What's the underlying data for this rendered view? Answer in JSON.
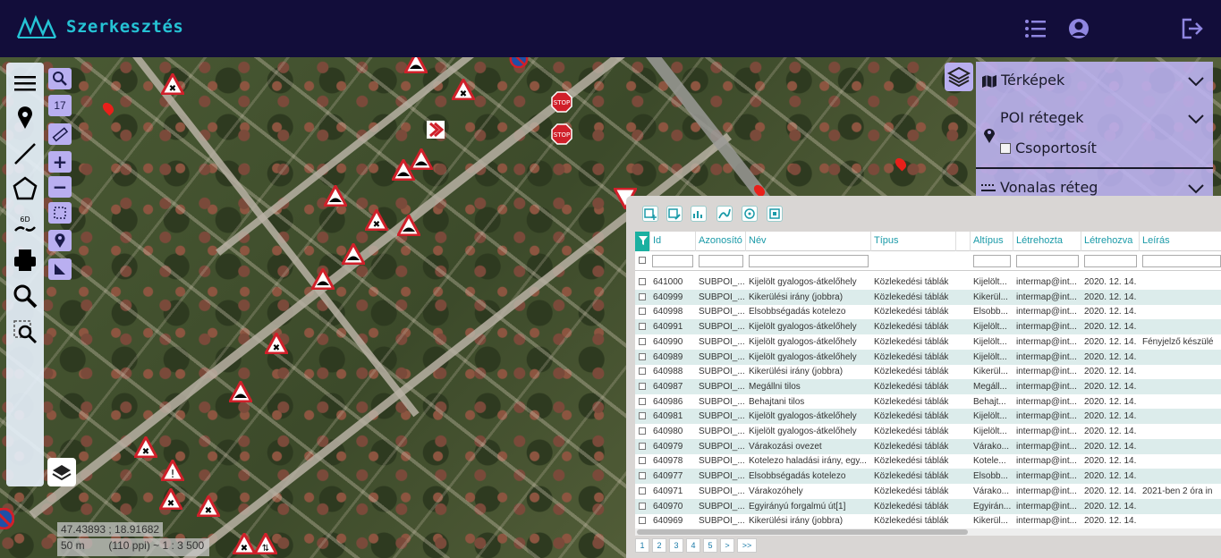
{
  "header": {
    "title": "Szerkesztés",
    "icons": [
      "list-icon",
      "user-icon",
      "logout-icon"
    ],
    "bg_color": "#120d3a",
    "accent": "#25c3d5"
  },
  "map": {
    "zoom_level": "17",
    "coordinates": "47.43893 ; 18.91682",
    "scale_distance": "50 m",
    "scale_ratio": "(110 ppi) ~ 1 : 3 500"
  },
  "layers_panel": {
    "maps_label": "Térképek",
    "poi_label": "POI rétegek",
    "group_label": "Csoportosít",
    "line_layer_label": "Vonalas réteg"
  },
  "table": {
    "columns": [
      "Id",
      "Azonosító",
      "Név",
      "Típus",
      "",
      "Altípus",
      "Létrehozta",
      "Létrehozva",
      "Leírás"
    ],
    "rows": [
      {
        "id": "641000",
        "azon": "SUBPOI_...",
        "nev": "Kijelölt gyalogos-átkelőhely",
        "tipus": "Közlekedési táblák",
        "alt": "Kijelölt...",
        "letrehozta": "intermap@int...",
        "datum": "2020. 12. 14.",
        "leiras": ""
      },
      {
        "id": "640999",
        "azon": "SUBPOI_...",
        "nev": "Kikerülési irány (jobbra)",
        "tipus": "Közlekedési táblák",
        "alt": "Kikerül...",
        "letrehozta": "intermap@int...",
        "datum": "2020. 12. 14.",
        "leiras": ""
      },
      {
        "id": "640998",
        "azon": "SUBPOI_...",
        "nev": "Elsobbségadás kotelezo",
        "tipus": "Közlekedési táblák",
        "alt": "Elsobb...",
        "letrehozta": "intermap@int...",
        "datum": "2020. 12. 14.",
        "leiras": ""
      },
      {
        "id": "640991",
        "azon": "SUBPOI_...",
        "nev": "Kijelölt gyalogos-átkelőhely",
        "tipus": "Közlekedési táblák",
        "alt": "Kijelölt...",
        "letrehozta": "intermap@int...",
        "datum": "2020. 12. 14.",
        "leiras": ""
      },
      {
        "id": "640990",
        "azon": "SUBPOI_...",
        "nev": "Kijelölt gyalogos-átkelőhely",
        "tipus": "Közlekedési táblák",
        "alt": "Kijelölt...",
        "letrehozta": "intermap@int...",
        "datum": "2020. 12. 14.",
        "leiras": "Fényjelző készülé"
      },
      {
        "id": "640989",
        "azon": "SUBPOI_...",
        "nev": "Kijelölt gyalogos-átkelőhely",
        "tipus": "Közlekedési táblák",
        "alt": "Kijelölt...",
        "letrehozta": "intermap@int...",
        "datum": "2020. 12. 14.",
        "leiras": ""
      },
      {
        "id": "640988",
        "azon": "SUBPOI_...",
        "nev": "Kikerülési irány (jobbra)",
        "tipus": "Közlekedési táblák",
        "alt": "Kikerül...",
        "letrehozta": "intermap@int...",
        "datum": "2020. 12. 14.",
        "leiras": ""
      },
      {
        "id": "640987",
        "azon": "SUBPOI_...",
        "nev": "Megállni tilos",
        "tipus": "Közlekedési táblák",
        "alt": "Megáll...",
        "letrehozta": "intermap@int...",
        "datum": "2020. 12. 14.",
        "leiras": ""
      },
      {
        "id": "640986",
        "azon": "SUBPOI_...",
        "nev": "Behajtani tilos",
        "tipus": "Közlekedési táblák",
        "alt": "Behajt...",
        "letrehozta": "intermap@int...",
        "datum": "2020. 12. 14.",
        "leiras": ""
      },
      {
        "id": "640981",
        "azon": "SUBPOI_...",
        "nev": "Kijelölt gyalogos-átkelőhely",
        "tipus": "Közlekedési táblák",
        "alt": "Kijelölt...",
        "letrehozta": "intermap@int...",
        "datum": "2020. 12. 14.",
        "leiras": ""
      },
      {
        "id": "640980",
        "azon": "SUBPOI_...",
        "nev": "Kijelölt gyalogos-átkelőhely",
        "tipus": "Közlekedési táblák",
        "alt": "Kijelölt...",
        "letrehozta": "intermap@int...",
        "datum": "2020. 12. 14.",
        "leiras": ""
      },
      {
        "id": "640979",
        "azon": "SUBPOI_...",
        "nev": "Várakozási ovezet",
        "tipus": "Közlekedési táblák",
        "alt": "Várako...",
        "letrehozta": "intermap@int...",
        "datum": "2020. 12. 14.",
        "leiras": ""
      },
      {
        "id": "640978",
        "azon": "SUBPOI_...",
        "nev": "Kotelezo haladási irány, egy...",
        "tipus": "Közlekedési táblák",
        "alt": "Kotele...",
        "letrehozta": "intermap@int...",
        "datum": "2020. 12. 14.",
        "leiras": ""
      },
      {
        "id": "640977",
        "azon": "SUBPOI_...",
        "nev": "Elsobbségadás kotelezo",
        "tipus": "Közlekedési táblák",
        "alt": "Elsobb...",
        "letrehozta": "intermap@int...",
        "datum": "2020. 12. 14.",
        "leiras": ""
      },
      {
        "id": "640971",
        "azon": "SUBPOI_...",
        "nev": "Várakozóhely",
        "tipus": "Közlekedési táblák",
        "alt": "Várako...",
        "letrehozta": "intermap@int...",
        "datum": "2020. 12. 14.",
        "leiras": "2021-ben 2 óra in"
      },
      {
        "id": "640970",
        "azon": "SUBPOI_...",
        "nev": "Egyirányú forgalmú út[1]",
        "tipus": "Közlekedési táblák",
        "alt": "Egyirán...",
        "letrehozta": "intermap@int...",
        "datum": "2020. 12. 14.",
        "leiras": ""
      },
      {
        "id": "640969",
        "azon": "SUBPOI_...",
        "nev": "Kikerülési irány (jobbra)",
        "tipus": "Közlekedési táblák",
        "alt": "Kikerül...",
        "letrehozta": "intermap@int...",
        "datum": "2020. 12. 14.",
        "leiras": ""
      }
    ],
    "pages": [
      "1",
      "2",
      "3",
      "4",
      "5",
      ">",
      ">>"
    ]
  }
}
